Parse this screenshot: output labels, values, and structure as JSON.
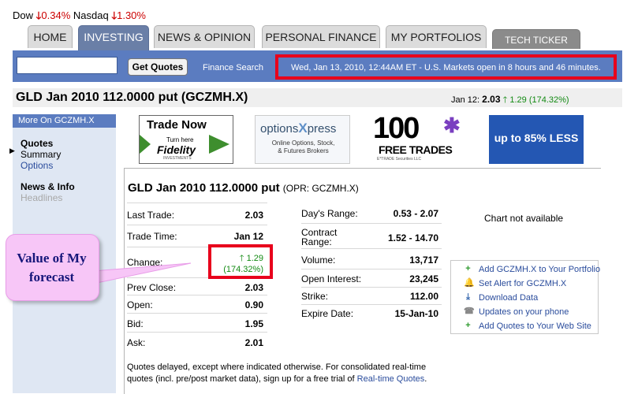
{
  "index": {
    "dow_label": "Dow",
    "dow_change": "0.34%",
    "nasdaq_label": "Nasdaq",
    "nasdaq_change": "1.30%"
  },
  "nav": {
    "tabs": [
      "HOME",
      "INVESTING",
      "NEWS & OPINION",
      "PERSONAL FINANCE",
      "MY PORTFOLIOS"
    ],
    "active": "INVESTING",
    "tech_ticker": "TECH TICKER"
  },
  "searchbar": {
    "input_value": "",
    "button": "Get Quotes",
    "finance_search": "Finance Search",
    "market_status": "Wed, Jan 13, 2010, 12:44AM ET - U.S. Markets open in 8 hours and 46 minutes."
  },
  "header": {
    "title": "GLD Jan 2010 112.0000 put (GCZMH.X)",
    "date": "Jan 12:",
    "price": "2.03",
    "change": "1.29 (174.32%)"
  },
  "sidebar": {
    "heading": "More On GCZMH.X",
    "quotes": "Quotes",
    "summary": "Summary",
    "options": "Options",
    "news_info": "News & Info",
    "headlines": "Headlines"
  },
  "ads": {
    "fidelity_top": "Trade Now",
    "fidelity_small": "Turn here",
    "fidelity_brand": "Fidelity",
    "fidelity_sub": "INVESTMENTS",
    "ox_brand_a": "options",
    "ox_brand_b": "X",
    "ox_brand_c": "press",
    "ox_line1": "Online Options, Stock,",
    "ox_line2": "& Futures Brokers",
    "et_number": "100",
    "et_text": "FREE TRADES",
    "et_sub": "E*TRADE Securities LLC",
    "upto": "up to 85% LESS"
  },
  "quote": {
    "title": "GLD Jan 2010 112.0000 put",
    "opr": "(OPR: GCZMH.X)",
    "left_rows": [
      {
        "label": "Last Trade:",
        "value": "2.03"
      },
      {
        "label": "Trade Time:",
        "value": "Jan 12"
      },
      {
        "label": "Change:",
        "value": "1.29",
        "value2": "(174.32%)"
      },
      {
        "label": "Prev Close:",
        "value": "2.03"
      },
      {
        "label": "Open:",
        "value": "0.90"
      },
      {
        "label": "Bid:",
        "value": "1.95"
      },
      {
        "label": "Ask:",
        "value": "2.01"
      }
    ],
    "right_rows": [
      {
        "label": "Day's Range:",
        "value": "0.53 - 2.07"
      },
      {
        "label": "Contract",
        "label2": "Range:",
        "value": "1.52 - 14.70"
      },
      {
        "label": "Volume:",
        "value": "13,717"
      },
      {
        "label": "Open Interest:",
        "value": "23,245"
      },
      {
        "label": "Strike:",
        "value": "112.00"
      },
      {
        "label": "Expire Date:",
        "value": "15-Jan-10"
      }
    ],
    "chart_na": "Chart not available"
  },
  "actions": [
    {
      "label": "Add GCZMH.X to Your Portfolio",
      "icon": "plus-icon",
      "color": "#2e9a2e"
    },
    {
      "label": "Set Alert for GCZMH.X",
      "icon": "bell-icon",
      "color": "#e0a000"
    },
    {
      "label": "Download Data",
      "icon": "download-icon",
      "color": "#3a6ab0"
    },
    {
      "label": "Updates on your phone",
      "icon": "phone-icon",
      "color": "#888888"
    },
    {
      "label": "Add Quotes to Your Web Site",
      "icon": "plus-icon",
      "color": "#2e9a2e"
    }
  ],
  "footnote": {
    "text": "Quotes delayed, except where indicated otherwise. For consolidated real-time quotes (incl. pre/post market data), sign up for a free trial of",
    "link": "Real-time Quotes",
    "end": "."
  },
  "annotation": {
    "callout": "Value of My forecast"
  }
}
